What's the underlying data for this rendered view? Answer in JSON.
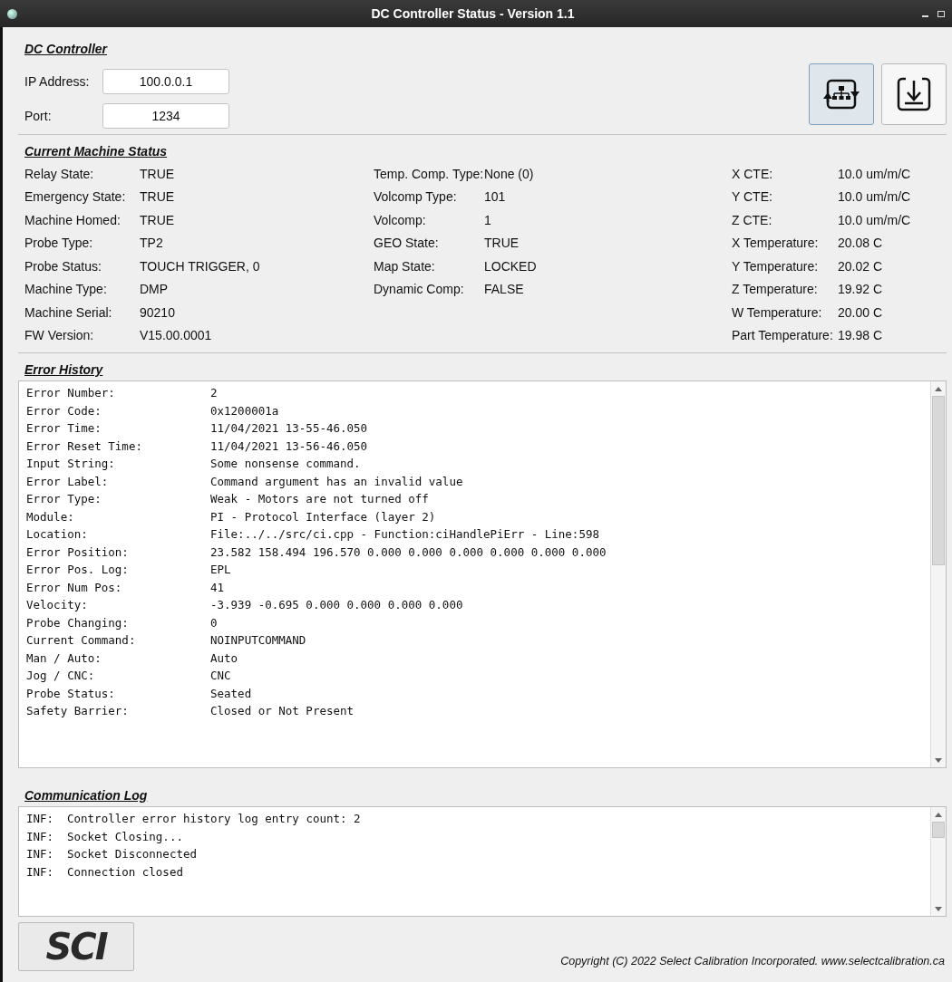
{
  "window": {
    "title": "DC Controller Status - Version 1.1"
  },
  "dc_controller": {
    "heading": "DC Controller",
    "fields": [
      {
        "label": "IP Address:",
        "value": "100.0.0.1"
      },
      {
        "label": "Port:",
        "value": "1234"
      }
    ],
    "buttons": [
      {
        "kind": "connect",
        "selected": true
      },
      {
        "kind": "download",
        "selected": false
      }
    ]
  },
  "machine_status": {
    "heading": "Current Machine Status",
    "columns": [
      [
        {
          "label": "Relay State:",
          "value": "TRUE"
        },
        {
          "label": "Emergency State:",
          "value": "TRUE"
        },
        {
          "label": "Machine Homed:",
          "value": "TRUE"
        },
        {
          "label": "Probe Type:",
          "value": "TP2"
        },
        {
          "label": "Probe Status:",
          "value": "TOUCH TRIGGER, 0"
        },
        {
          "label": "Machine Type:",
          "value": "DMP"
        },
        {
          "label": "Machine Serial:",
          "value": "90210"
        },
        {
          "label": "FW Version:",
          "value": "V15.00.0001"
        }
      ],
      [
        {
          "label": "Temp. Comp. Type:",
          "value": "None (0)"
        },
        {
          "label": "Volcomp Type:",
          "value": "101"
        },
        {
          "label": "Volcomp:",
          "value": "1"
        },
        {
          "label": "GEO State:",
          "value": "TRUE"
        },
        {
          "label": "Map State:",
          "value": "LOCKED"
        },
        {
          "label": "Dynamic Comp:",
          "value": "FALSE"
        }
      ],
      [
        {
          "label": "X CTE:",
          "value": "10.0 um/m/C"
        },
        {
          "label": "Y CTE:",
          "value": "10.0 um/m/C"
        },
        {
          "label": "Z CTE:",
          "value": "10.0 um/m/C"
        },
        {
          "label": "X Temperature:",
          "value": "20.08 C"
        },
        {
          "label": "Y Temperature:",
          "value": "20.02 C"
        },
        {
          "label": "Z Temperature:",
          "value": "19.92 C"
        },
        {
          "label": "W Temperature:",
          "value": "20.00 C"
        },
        {
          "label": "Part Temperature:",
          "value": "19.98 C"
        }
      ]
    ]
  },
  "error_history": {
    "heading": "Error History",
    "rows": [
      {
        "label": "Error Number:",
        "value": "2"
      },
      {
        "label": "Error Code:",
        "value": "0x1200001a"
      },
      {
        "label": "Error Time:",
        "value": "11/04/2021 13-55-46.050"
      },
      {
        "label": "Error Reset Time:",
        "value": "11/04/2021 13-56-46.050"
      },
      {
        "label": "Input String:",
        "value": "Some nonsense command."
      },
      {
        "label": "Error Label:",
        "value": "Command argument has an invalid value"
      },
      {
        "label": "Error Type:",
        "value": "Weak - Motors are not turned off"
      },
      {
        "label": "Module:",
        "value": "PI - Protocol Interface (layer 2)"
      },
      {
        "label": "Location:",
        "value": "File:../../src/ci.cpp - Function:ciHandlePiErr - Line:598"
      },
      {
        "label": "Error Position:",
        "value": "23.582 158.494 196.570 0.000 0.000 0.000 0.000 0.000 0.000"
      },
      {
        "label": "Error Pos. Log:",
        "value": "EPL"
      },
      {
        "label": "Error Num Pos:",
        "value": "41"
      },
      {
        "label": "Velocity:",
        "value": "-3.939 -0.695 0.000 0.000 0.000 0.000"
      },
      {
        "label": "Probe Changing:",
        "value": "0"
      },
      {
        "label": "Current Command:",
        "value": "NOINPUTCOMMAND"
      },
      {
        "label": "Man / Auto:",
        "value": "Auto"
      },
      {
        "label": "Jog / CNC:",
        "value": "CNC"
      },
      {
        "label": "Probe Status:",
        "value": "Seated"
      },
      {
        "label": "Safety Barrier:",
        "value": "Closed or Not Present"
      }
    ]
  },
  "communication_log": {
    "heading": "Communication Log",
    "lines": [
      {
        "level": "INF:",
        "message": "Controller error history log entry count: 2"
      },
      {
        "level": "INF:",
        "message": "Socket Closing..."
      },
      {
        "level": "INF:",
        "message": "Socket Disconnected"
      },
      {
        "level": "INF:",
        "message": "Connection closed"
      }
    ]
  },
  "footer": {
    "logo": "SCI",
    "copyright": "Copyright (C) 2022 Select Calibration Incorporated.  www.selectcalibration.ca"
  }
}
